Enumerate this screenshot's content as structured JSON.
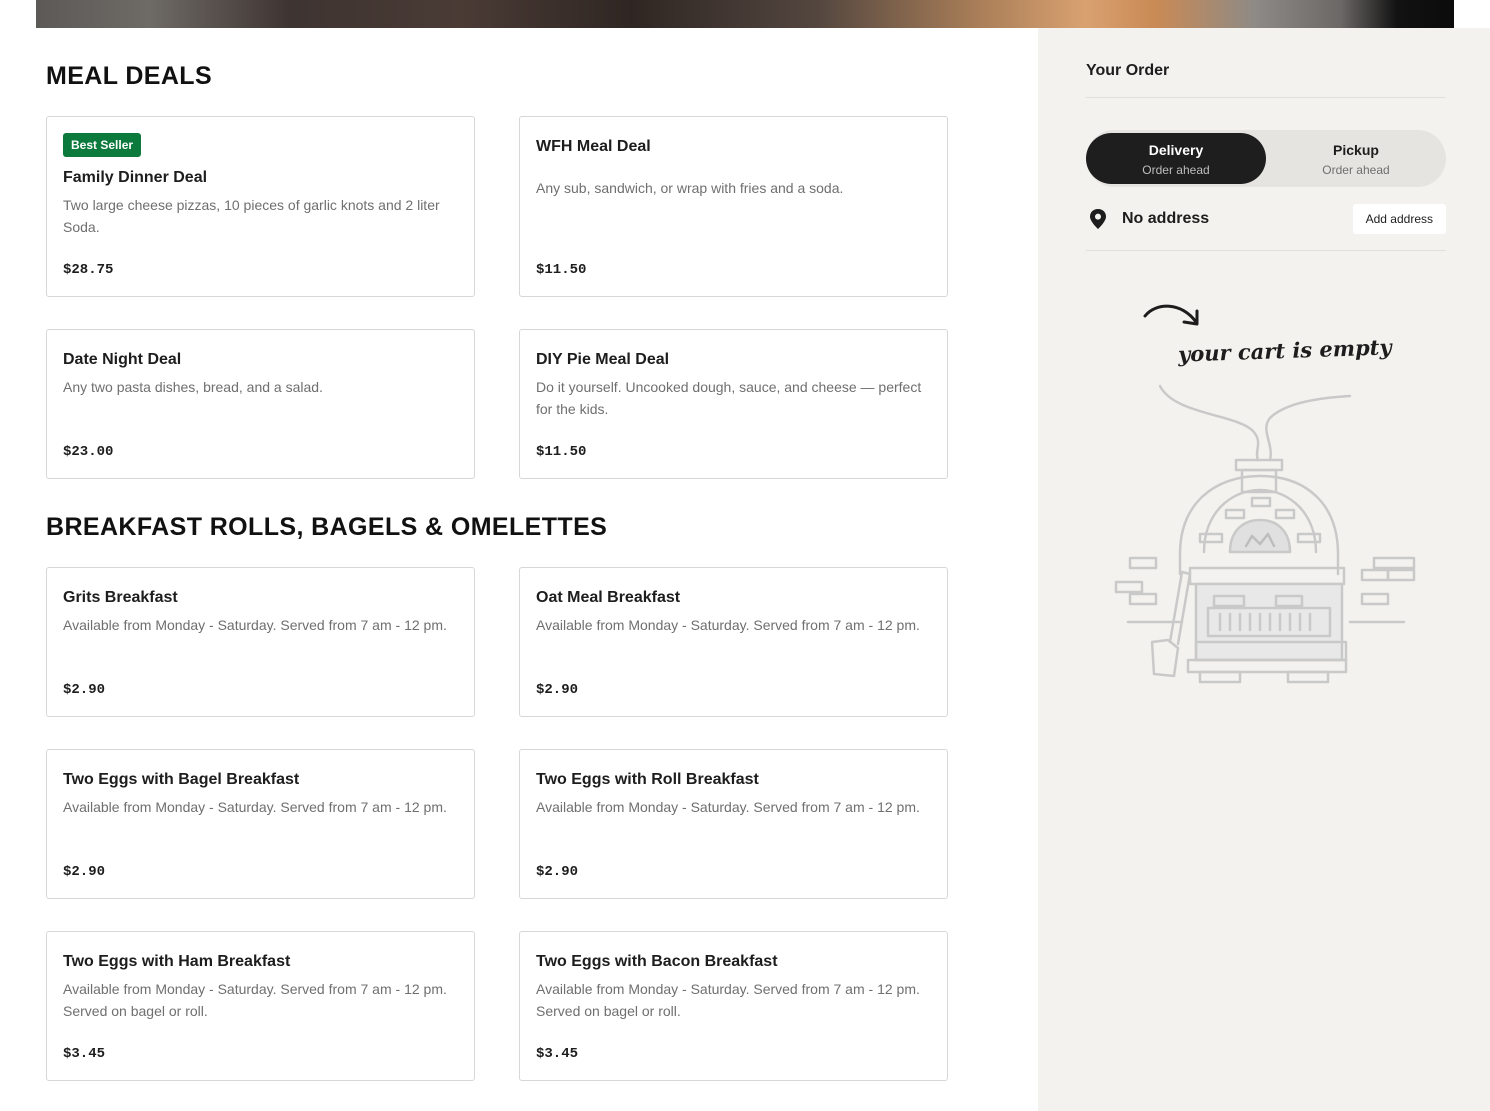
{
  "colors": {
    "badge": "#0b7a3c",
    "toggle_active": "#1e1e1e",
    "sidebar_bg": "#f3f2ee"
  },
  "sections": [
    {
      "title": "MEAL DEALS",
      "items": [
        {
          "badge": "Best Seller",
          "name": "Family Dinner Deal",
          "desc": "Two large cheese pizzas, 10 pieces of garlic knots and 2 liter Soda.",
          "price": "$28.75"
        },
        {
          "name": "WFH Meal Deal",
          "desc": "Any sub, sandwich, or wrap with fries and a soda.",
          "price": "$11.50"
        },
        {
          "name": "Date Night Deal",
          "desc": "Any two pasta dishes, bread, and a salad.",
          "price": "$23.00"
        },
        {
          "name": "DIY Pie Meal Deal",
          "desc": "Do it yourself. Uncooked dough, sauce, and cheese — perfect for the kids.",
          "price": "$11.50"
        }
      ]
    },
    {
      "title": "BREAKFAST ROLLS, BAGELS & OMELETTES",
      "items": [
        {
          "name": "Grits Breakfast",
          "desc": "Available from Monday - Saturday. Served from 7 am - 12 pm.",
          "price": "$2.90"
        },
        {
          "name": "Oat Meal Breakfast",
          "desc": "Available from Monday - Saturday. Served from 7 am - 12 pm.",
          "price": "$2.90"
        },
        {
          "name": "Two Eggs with Bagel Breakfast",
          "desc": "Available from Monday - Saturday. Served from 7 am - 12 pm.",
          "price": "$2.90"
        },
        {
          "name": "Two Eggs with Roll Breakfast",
          "desc": "Available from Monday - Saturday. Served from 7 am - 12 pm.",
          "price": "$2.90"
        },
        {
          "name": "Two Eggs with Ham Breakfast",
          "desc": "Available from Monday - Saturday. Served from 7 am - 12 pm. Served on bagel or roll.",
          "price": "$3.45"
        },
        {
          "name": "Two Eggs with Bacon Breakfast",
          "desc": "Available from Monday - Saturday. Served from 7 am - 12 pm. Served on bagel or roll.",
          "price": "$3.45"
        }
      ]
    }
  ],
  "order": {
    "title": "Your Order",
    "delivery": {
      "label": "Delivery",
      "sub": "Order ahead"
    },
    "pickup": {
      "label": "Pickup",
      "sub": "Order ahead"
    },
    "address": "No address",
    "add_address": "Add address",
    "empty_text": "your cart is empty",
    "empty_icon": "pizza-oven-icon",
    "pin_icon": "location-pin-icon"
  }
}
